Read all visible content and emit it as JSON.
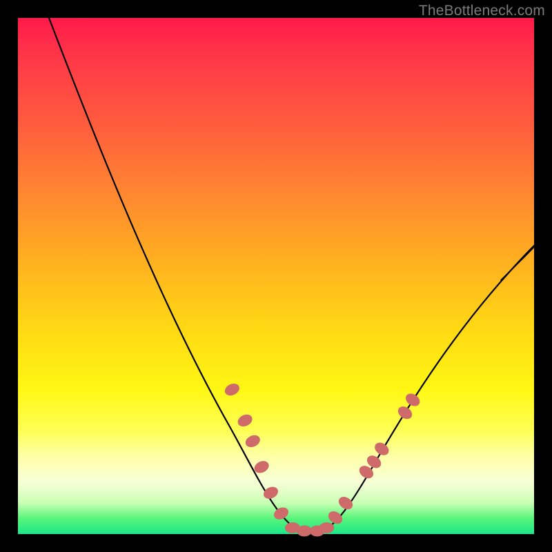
{
  "watermark": "TheBottleneck.com",
  "colors": {
    "background_frame": "#000000",
    "gradient_stops": [
      "#ff1a4b",
      "#ff3848",
      "#ff5a3e",
      "#ff8a2f",
      "#ffb31f",
      "#ffd814",
      "#fff714",
      "#feff55",
      "#feffa7",
      "#f7ffd7",
      "#c9ffb4",
      "#57f479",
      "#1de88a"
    ],
    "curve": "#000000",
    "beads": "#cf6a6a"
  },
  "chart_data": {
    "type": "line",
    "title": "",
    "xlabel": "",
    "ylabel": "",
    "xlim": [
      0,
      100
    ],
    "ylim": [
      0,
      100
    ],
    "grid": false,
    "legend": false,
    "series": [
      {
        "name": "bottleneck-curve",
        "x": [
          6,
          10,
          15,
          20,
          25,
          30,
          35,
          40,
          42,
          44,
          46,
          48,
          50,
          52,
          54,
          56,
          58,
          60,
          62,
          65,
          70,
          75,
          80,
          85,
          90,
          95,
          100
        ],
        "y": [
          100,
          92,
          82,
          72,
          62,
          52,
          42,
          32,
          27,
          22,
          17,
          11,
          6,
          3,
          1,
          0.5,
          0.5,
          1,
          3,
          7,
          14,
          22,
          30,
          38,
          45,
          51,
          56
        ]
      }
    ],
    "markers": [
      {
        "name": "left-bead-1",
        "x": 41.5,
        "y": 28
      },
      {
        "name": "left-bead-2",
        "x": 44.0,
        "y": 22
      },
      {
        "name": "left-bead-3",
        "x": 45.5,
        "y": 18
      },
      {
        "name": "left-bead-4",
        "x": 47.2,
        "y": 13
      },
      {
        "name": "left-bead-5",
        "x": 49.0,
        "y": 8
      },
      {
        "name": "left-bead-6",
        "x": 51.0,
        "y": 4
      },
      {
        "name": "bottom-bead-1",
        "x": 53.2,
        "y": 1.2
      },
      {
        "name": "bottom-bead-2",
        "x": 55.5,
        "y": 0.6
      },
      {
        "name": "bottom-bead-3",
        "x": 58.0,
        "y": 0.6
      },
      {
        "name": "bottom-bead-4",
        "x": 59.8,
        "y": 1.2
      },
      {
        "name": "right-bead-1",
        "x": 61.5,
        "y": 3.2
      },
      {
        "name": "right-bead-2",
        "x": 63.5,
        "y": 6
      },
      {
        "name": "right-bead-3",
        "x": 67.5,
        "y": 12
      },
      {
        "name": "right-bead-4",
        "x": 69.0,
        "y": 14
      },
      {
        "name": "right-bead-5",
        "x": 70.5,
        "y": 16.5
      },
      {
        "name": "right-bead-6",
        "x": 75.0,
        "y": 23.5
      },
      {
        "name": "right-bead-7",
        "x": 76.5,
        "y": 26
      }
    ]
  }
}
